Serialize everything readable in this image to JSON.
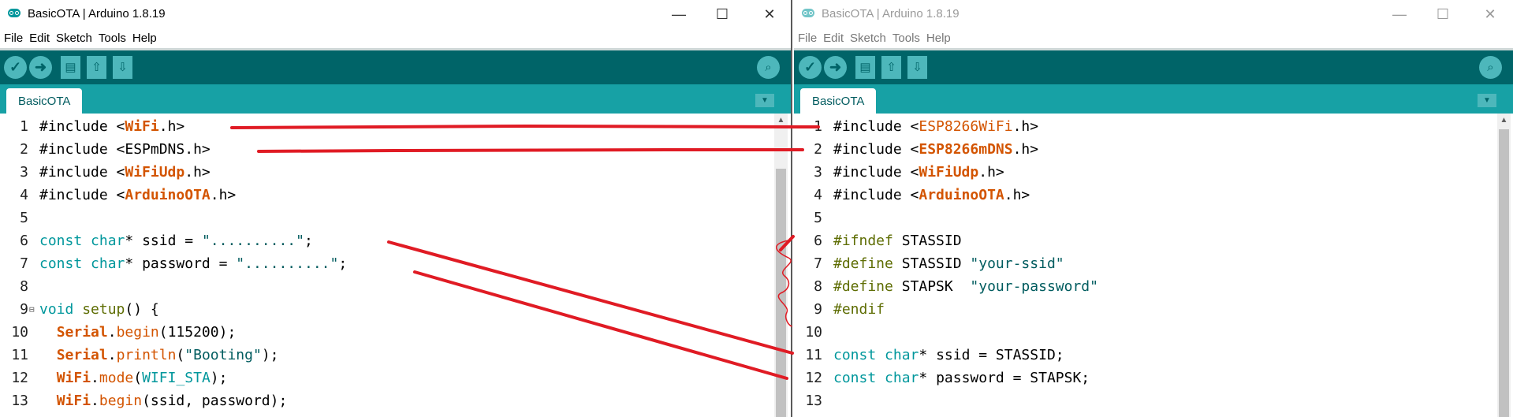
{
  "left": {
    "title": "BasicOTA | Arduino 1.8.19",
    "window_controls": [
      "—",
      "☐",
      "✕"
    ],
    "menu": [
      "File",
      "Edit",
      "Sketch",
      "Tools",
      "Help"
    ],
    "tab": "BasicOTA",
    "line_numbers": [
      "1",
      "2",
      "3",
      "4",
      "5",
      "6",
      "7",
      "8",
      "9",
      "10",
      "11",
      "12",
      "13"
    ],
    "fold_marker": "⊟",
    "code": [
      {
        "parts": [
          [
            "d",
            "#include <"
          ],
          [
            "cls",
            "WiFi"
          ],
          [
            "d",
            ".h>"
          ]
        ]
      },
      {
        "parts": [
          [
            "d",
            "#include <ESPmDNS.h>"
          ]
        ]
      },
      {
        "parts": [
          [
            "d",
            "#include <"
          ],
          [
            "cls",
            "WiFiUdp"
          ],
          [
            "d",
            ".h>"
          ]
        ]
      },
      {
        "parts": [
          [
            "d",
            "#include <"
          ],
          [
            "cls",
            "ArduinoOTA"
          ],
          [
            "d",
            ".h>"
          ]
        ]
      },
      {
        "parts": []
      },
      {
        "parts": [
          [
            "ty",
            "const"
          ],
          [
            "d",
            " "
          ],
          [
            "ty",
            "char"
          ],
          [
            "d",
            "* ssid = "
          ],
          [
            "str",
            "\"..........\""
          ],
          [
            "d",
            ";"
          ]
        ]
      },
      {
        "parts": [
          [
            "ty",
            "const"
          ],
          [
            "d",
            " "
          ],
          [
            "ty",
            "char"
          ],
          [
            "d",
            "* password = "
          ],
          [
            "str",
            "\"..........\""
          ],
          [
            "d",
            ";"
          ]
        ]
      },
      {
        "parts": []
      },
      {
        "parts": [
          [
            "ty",
            "void"
          ],
          [
            "d",
            " "
          ],
          [
            "kw",
            "setup"
          ],
          [
            "d",
            "() {"
          ]
        ]
      },
      {
        "parts": [
          [
            "d",
            "  "
          ],
          [
            "cls",
            "Serial"
          ],
          [
            "d",
            "."
          ],
          [
            "fn",
            "begin"
          ],
          [
            "d",
            "(115200);"
          ]
        ]
      },
      {
        "parts": [
          [
            "d",
            "  "
          ],
          [
            "cls",
            "Serial"
          ],
          [
            "d",
            "."
          ],
          [
            "fn",
            "println"
          ],
          [
            "d",
            "("
          ],
          [
            "str",
            "\"Booting\""
          ],
          [
            "d",
            ");"
          ]
        ]
      },
      {
        "parts": [
          [
            "d",
            "  "
          ],
          [
            "cls",
            "WiFi"
          ],
          [
            "d",
            "."
          ],
          [
            "fn",
            "mode"
          ],
          [
            "d",
            "("
          ],
          [
            "cst",
            "WIFI_STA"
          ],
          [
            "d",
            ");"
          ]
        ]
      },
      {
        "parts": [
          [
            "d",
            "  "
          ],
          [
            "cls",
            "WiFi"
          ],
          [
            "d",
            "."
          ],
          [
            "fn",
            "begin"
          ],
          [
            "d",
            "(ssid, password);"
          ]
        ]
      }
    ]
  },
  "right": {
    "title": "BasicOTA | Arduino 1.8.19",
    "window_controls": [
      "—",
      "☐",
      "✕"
    ],
    "menu": [
      "File",
      "Edit",
      "Sketch",
      "Tools",
      "Help"
    ],
    "tab": "BasicOTA",
    "line_numbers": [
      "1",
      "2",
      "3",
      "4",
      "5",
      "6",
      "7",
      "8",
      "9",
      "10",
      "11",
      "12",
      "13"
    ],
    "code": [
      {
        "parts": [
          [
            "d",
            "#include <"
          ],
          [
            "fn",
            "ESP8266WiFi"
          ],
          [
            "d",
            ".h>"
          ]
        ]
      },
      {
        "parts": [
          [
            "d",
            "#include <"
          ],
          [
            "cls",
            "ESP8266mDNS"
          ],
          [
            "d",
            ".h>"
          ]
        ]
      },
      {
        "parts": [
          [
            "d",
            "#include <"
          ],
          [
            "cls",
            "WiFiUdp"
          ],
          [
            "d",
            ".h>"
          ]
        ]
      },
      {
        "parts": [
          [
            "d",
            "#include <"
          ],
          [
            "cls",
            "ArduinoOTA"
          ],
          [
            "d",
            ".h>"
          ]
        ]
      },
      {
        "parts": []
      },
      {
        "parts": [
          [
            "kw",
            "#ifndef"
          ],
          [
            "d",
            " STASSID"
          ]
        ]
      },
      {
        "parts": [
          [
            "kw",
            "#define"
          ],
          [
            "d",
            " STASSID "
          ],
          [
            "str",
            "\"your-ssid\""
          ]
        ]
      },
      {
        "parts": [
          [
            "kw",
            "#define"
          ],
          [
            "d",
            " STAPSK  "
          ],
          [
            "str",
            "\"your-password\""
          ]
        ]
      },
      {
        "parts": [
          [
            "kw",
            "#endif"
          ]
        ]
      },
      {
        "parts": []
      },
      {
        "parts": [
          [
            "ty",
            "const"
          ],
          [
            "d",
            " "
          ],
          [
            "ty",
            "char"
          ],
          [
            "d",
            "* ssid = STASSID;"
          ]
        ]
      },
      {
        "parts": [
          [
            "ty",
            "const"
          ],
          [
            "d",
            " "
          ],
          [
            "ty",
            "char"
          ],
          [
            "d",
            "* password = STAPSK;"
          ]
        ]
      },
      {
        "parts": []
      }
    ]
  },
  "colors": {
    "toolbar": "#006468",
    "tabbar": "#17a1a5",
    "button": "#4db7bb",
    "annotation_red": "#e01b24"
  },
  "icons": {
    "verify": "checkmark-icon",
    "upload": "right-arrow-icon",
    "new": "new-file-icon",
    "open": "open-up-arrow-icon",
    "save": "save-down-arrow-icon",
    "serial_monitor": "magnifier-icon",
    "tab_menu": "down-triangle-icon"
  }
}
